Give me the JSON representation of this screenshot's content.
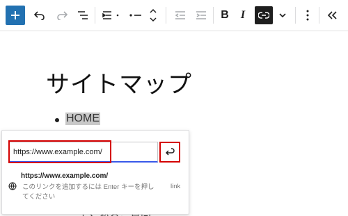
{
  "toolbar": {
    "add_label": "+",
    "bold_label": "B",
    "italic_label": "I"
  },
  "content": {
    "heading": "サイトマップ",
    "list_item_1": "HOME",
    "list_item_peek": "よくあるご質問"
  },
  "link_popover": {
    "url_value": "https://www.example.com/",
    "suggestion_title": "https://www.example.com/",
    "suggestion_description": "このリンクを追加するには Enter キーを押してください",
    "suggestion_type": "link"
  },
  "colors": {
    "accent": "#2271b1",
    "highlight": "#d40000",
    "focus": "#3858e9"
  }
}
